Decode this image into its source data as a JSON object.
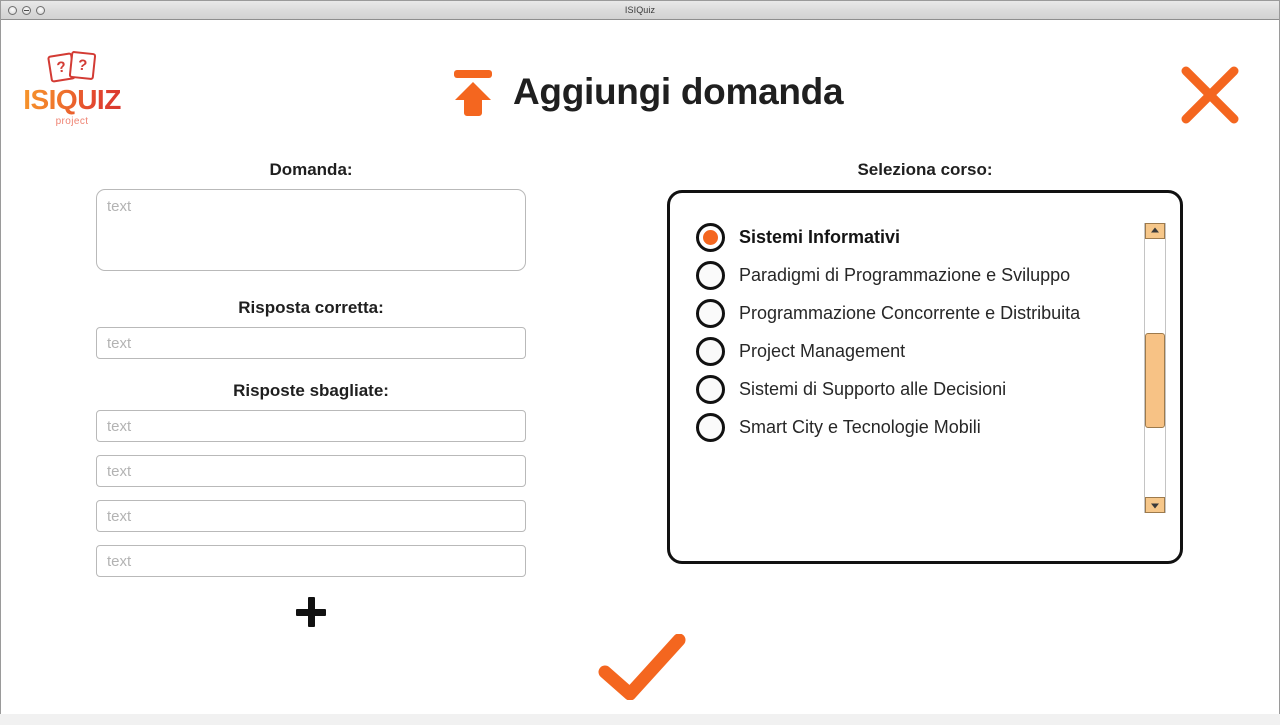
{
  "window": {
    "title": "ISIQuiz",
    "controls": [
      "close",
      "minimize",
      "maximize"
    ]
  },
  "logo": {
    "card_left_glyph": "?",
    "card_right_glyph": "?",
    "wordmark": "ISIQUIZ",
    "subtitle": "project",
    "gradient_from": "#F79A2B",
    "gradient_to": "#D8362F",
    "subtitle_color": "#EF8372"
  },
  "header": {
    "title": "Aggiungi domanda",
    "upload_icon": "upload-arrow-icon",
    "close_icon": "close-x-icon",
    "accent_color": "#F4661F"
  },
  "form": {
    "question": {
      "label": "Domanda:",
      "placeholder": "text",
      "value": ""
    },
    "correct_answer": {
      "label": "Risposta corretta:",
      "placeholder": "text",
      "value": ""
    },
    "wrong_answers": {
      "label": "Risposte sbagliate:",
      "fields": [
        {
          "placeholder": "text",
          "value": ""
        },
        {
          "placeholder": "text",
          "value": ""
        },
        {
          "placeholder": "text",
          "value": ""
        },
        {
          "placeholder": "text",
          "value": ""
        }
      ]
    },
    "add_button": {
      "icon": "plus-icon",
      "label": "+"
    }
  },
  "courses": {
    "label": "Seleziona corso:",
    "selected_index": 0,
    "items": [
      {
        "label": "Sistemi Informativi",
        "selected": true
      },
      {
        "label": "Paradigmi di Programmazione e Sviluppo",
        "selected": false
      },
      {
        "label": "Programmazione Concorrente e Distribuita",
        "selected": false
      },
      {
        "label": "Project Management",
        "selected": false
      },
      {
        "label": "Sistemi di Supporto alle Decisioni",
        "selected": false
      },
      {
        "label": "Smart City e Tecnologie Mobili",
        "selected": false
      }
    ],
    "scrollbar": {
      "up_arrow_icon": "triangle-up-icon",
      "down_arrow_icon": "triangle-down-icon",
      "thumb_color": "#F7C285"
    }
  },
  "confirm": {
    "icon": "check-icon",
    "color": "#F4661F"
  }
}
